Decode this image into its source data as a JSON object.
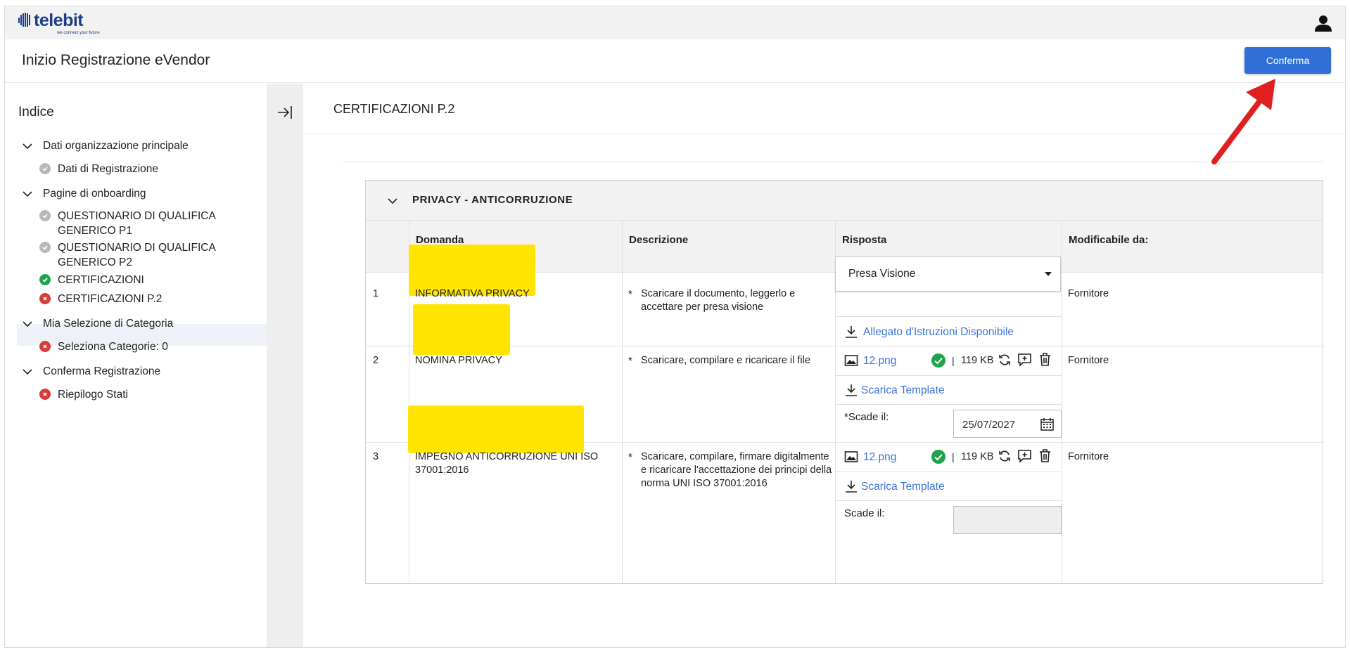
{
  "brand": {
    "logo_text": "telebit",
    "tagline": "we connect your future"
  },
  "header": {
    "title": "Inizio Registrazione eVendor",
    "confirm_label": "Conferma"
  },
  "sidebar": {
    "title": "Indice",
    "groups": [
      {
        "label": "Dati organizzazione principale",
        "items": [
          {
            "label": "Dati di Registrazione",
            "status": "grey"
          }
        ]
      },
      {
        "label": "Pagine di onboarding",
        "items": [
          {
            "label": "QUESTIONARIO DI QUALIFICA GENERICO P1",
            "line1": "QUESTIONARIO DI QUALIFICA",
            "line2": "GENERICO P1",
            "status": "grey"
          },
          {
            "label": "QUESTIONARIO DI QUALIFICA GENERICO P2",
            "line1": "QUESTIONARIO DI QUALIFICA",
            "line2": "GENERICO P2",
            "status": "grey"
          },
          {
            "label": "CERTIFICAZIONI",
            "status": "green"
          },
          {
            "label": "CERTIFICAZIONI P.2",
            "status": "red",
            "active": true
          }
        ]
      },
      {
        "label": "Mia Selezione di Categoria",
        "items": [
          {
            "label": "Seleziona Categorie: 0",
            "status": "red"
          }
        ]
      },
      {
        "label": "Conferma Registrazione",
        "items": [
          {
            "label": "Riepilogo Stati",
            "status": "red"
          }
        ]
      }
    ]
  },
  "main": {
    "section_title": "CERTIFICAZIONI P.2",
    "panel": {
      "title": "PRIVACY - ANTICORRUZIONE",
      "columns": {
        "domanda": "Domanda",
        "descrizione": "Descrizione",
        "risposta": "Risposta",
        "modificabile": "Modificabile da:"
      },
      "rows": [
        {
          "num": "1",
          "domanda": "INFORMATIVA PRIVACY",
          "descrizione": "Scaricare il documento, leggerlo e accettare per presa visione",
          "required_mark": "*",
          "risposta_select": "Presa Visione",
          "allegato_link": "Allegato d'Istruzioni Disponibile",
          "modificabile": "Fornitore"
        },
        {
          "num": "2",
          "domanda": "NOMINA PRIVACY",
          "descrizione": "Scaricare, compilare e ricaricare il file",
          "required_mark": "*",
          "file_name": "12.png",
          "file_size": "119 KB",
          "template_link": "Scarica Template",
          "scade_label": "*Scade il:",
          "scade_value": "25/07/2027",
          "modificabile": "Fornitore"
        },
        {
          "num": "3",
          "domanda": "IMPEGNO ANTICORRUZIONE UNI ISO 37001:2016",
          "domanda_line1": "IMPEGNO ANTICORRUZIONE UNI ISO",
          "domanda_line2": "37001:2016",
          "descrizione": "Scaricare, compilare, firmare digitalmente e ricaricare l'accettazione dei principi della norma UNI ISO 37001:2016",
          "required_mark": "*",
          "file_name": "12.png",
          "file_size": "119 KB",
          "template_link": "Scarica Template",
          "scade_label": "Scade il:",
          "scade_value": "",
          "modificabile": "Fornitore"
        }
      ]
    }
  },
  "colors": {
    "primary_button": "#2f6fd6",
    "link": "#3a74d9",
    "highlight": "#ffe500",
    "arrow": "#e02020",
    "status_green": "#1ea54c",
    "status_red": "#d93a3a",
    "status_grey": "#b8b8b8"
  }
}
